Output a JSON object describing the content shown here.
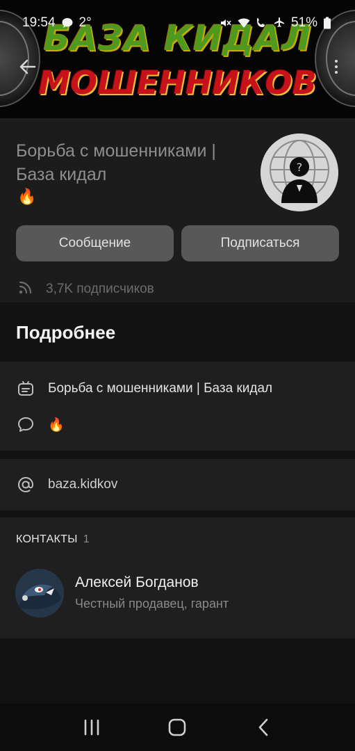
{
  "status_bar": {
    "time": "19:54",
    "temperature": "2°",
    "battery": "51%",
    "icons": [
      "chat-bubble-icon",
      "mute-icon",
      "wifi-icon",
      "wifi-call-icon",
      "airplane-icon",
      "battery-icon"
    ]
  },
  "cover": {
    "line1": "БАЗА КИДАЛ",
    "line2": "МОШЕННИКОВ"
  },
  "channel": {
    "title": "Борьба с мошенниками | База кидал",
    "emoji": "🔥",
    "message_button": "Сообщение",
    "subscribe_button": "Подписаться",
    "subscribers": "3,7K подписчиков"
  },
  "details": {
    "heading": "Подробнее",
    "description": "Борьба с мошенниками | База кидал",
    "status": "🔥",
    "link": "baza.kidkov"
  },
  "contacts": {
    "title": "КОНТАКТЫ",
    "count": "1",
    "items": [
      {
        "name": "Алексей Богданов",
        "subtitle": "Честный продавец, гарант"
      }
    ]
  },
  "colors": {
    "background": "#121212",
    "card": "#1f1f1f",
    "button": "#585858",
    "cover_red": "#c8121a",
    "cover_green": "#4f9a1e"
  }
}
